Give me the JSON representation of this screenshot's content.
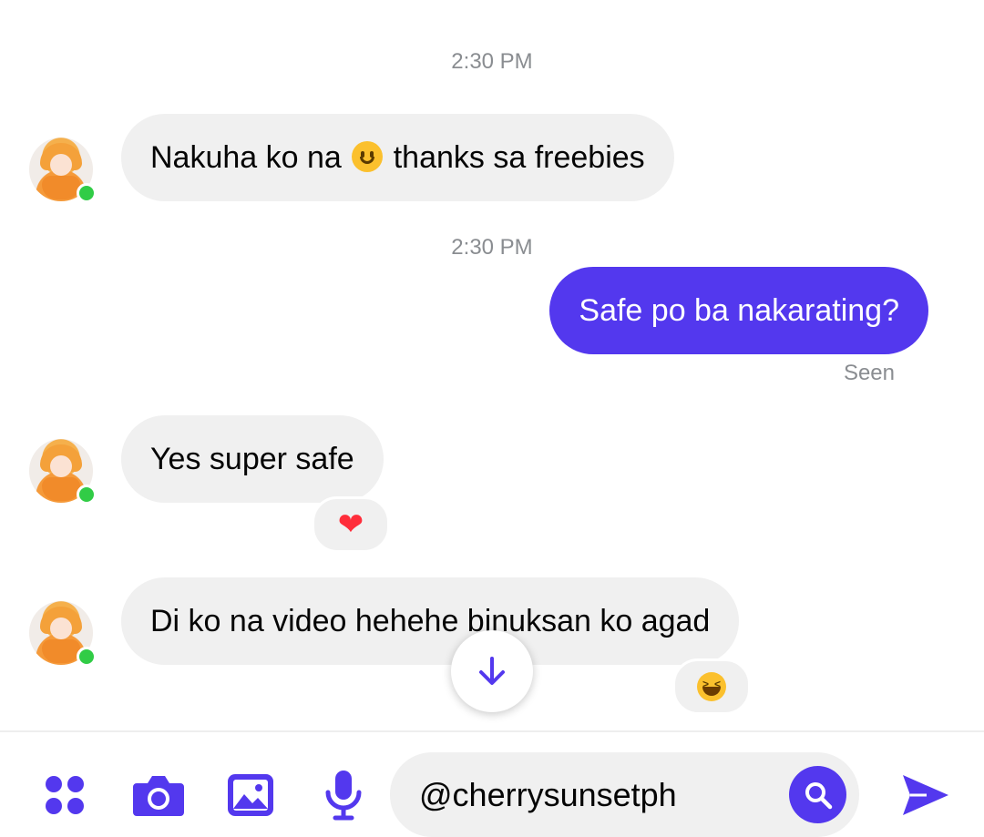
{
  "conversation": {
    "timestamps": [
      "2:30 PM",
      "2:30 PM"
    ],
    "messages": [
      {
        "sender": "incoming",
        "text_before": "Nakuha ko na",
        "emoji": "slightly-smiling-face",
        "text_after": "thanks sa freebies"
      },
      {
        "sender": "outgoing",
        "text": "Safe po ba nakarating?",
        "status": "Seen"
      },
      {
        "sender": "incoming",
        "text": "Yes super safe",
        "reaction": "heart"
      },
      {
        "sender": "incoming",
        "text": "Di ko na video hehehe binuksan ko agad",
        "reaction": "laughing-face"
      }
    ]
  },
  "contact": {
    "online": true,
    "online_color": "#31cc46"
  },
  "composer": {
    "input_value": "@cherrysunsetph",
    "tools": [
      "apps-icon",
      "camera-icon",
      "gallery-icon",
      "microphone-icon"
    ],
    "send": "send-icon"
  },
  "colors": {
    "accent": "#5338ee",
    "incoming_bubble": "#f0f0f0",
    "timestamp": "#8a8d91"
  }
}
